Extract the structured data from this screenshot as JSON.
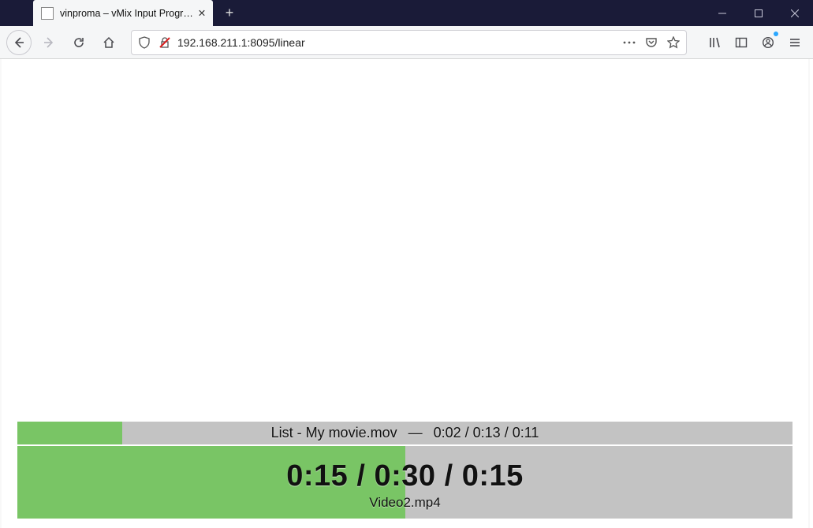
{
  "browser": {
    "tab_title": "vinproma – vMix Input Progress Mo",
    "url": "192.168.211.1:8095/linear"
  },
  "icons": {
    "newtab": "+",
    "close_tab": "✕",
    "minimize": "—",
    "maximize": "☐",
    "close": "✕"
  },
  "page": {
    "top_bar": {
      "title": "List - My movie.mov",
      "separator": "—",
      "elapsed": "0:02",
      "remaining": "0:13",
      "total": "0:11",
      "fill_percent": 13.5
    },
    "bottom_bar": {
      "elapsed": "0:15",
      "total": "0:30",
      "remaining": "0:15",
      "filename": "Video2.mp4",
      "fill_percent": 50
    }
  },
  "colors": {
    "bar_bg": "#c3c3c3",
    "bar_fill": "#79c565",
    "title_bg": "#1a1b38"
  }
}
